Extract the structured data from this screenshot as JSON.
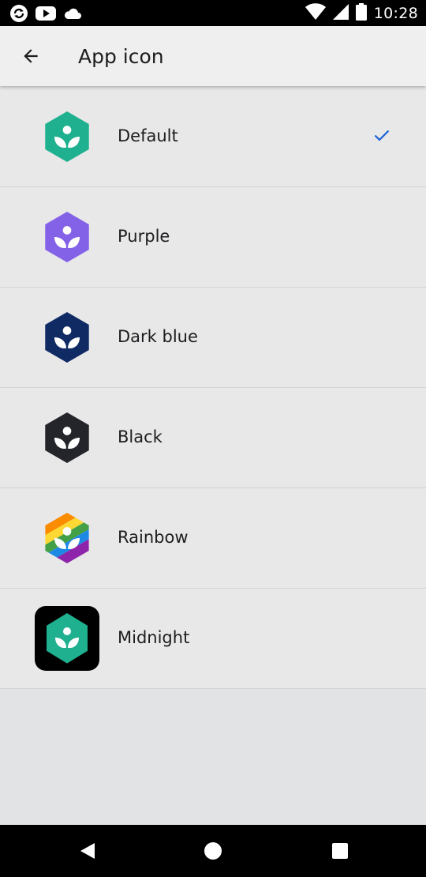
{
  "status_bar": {
    "time": "10:28",
    "left_icons": [
      "sync-icon",
      "youtube-icon",
      "cloud-icon"
    ],
    "right_icons": [
      "wifi-icon",
      "signal-icon",
      "battery-icon"
    ]
  },
  "app_bar": {
    "title": "App icon",
    "back_icon": "arrow-left-icon"
  },
  "colors": {
    "default": "#1fb18f",
    "purple": "#8462e8",
    "dark_blue": "#102b63",
    "black": "#23252a",
    "midnight_bg": "#000000",
    "check": "#1a5fd7"
  },
  "options": [
    {
      "label": "Default",
      "selected": true
    },
    {
      "label": "Purple",
      "selected": false
    },
    {
      "label": "Dark blue",
      "selected": false
    },
    {
      "label": "Black",
      "selected": false
    },
    {
      "label": "Rainbow",
      "selected": false
    },
    {
      "label": "Midnight",
      "selected": false
    }
  ]
}
